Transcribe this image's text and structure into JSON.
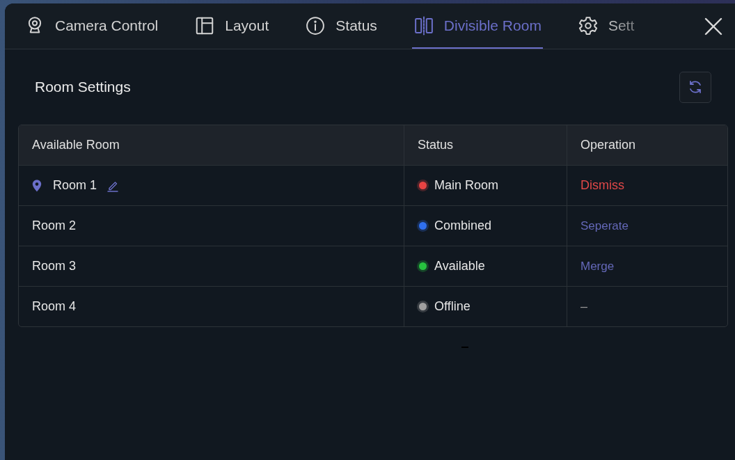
{
  "tabs": [
    {
      "label": "Camera Control",
      "selected": false
    },
    {
      "label": "Layout",
      "selected": false
    },
    {
      "label": "Status",
      "selected": false
    },
    {
      "label": "Divisible Room",
      "selected": true
    },
    {
      "label": "Sett",
      "selected": false
    }
  ],
  "panel": {
    "title": "Room Settings"
  },
  "table": {
    "columns": [
      "Available Room",
      "Status",
      "Operation"
    ],
    "rows": [
      {
        "room": "Room 1",
        "current": true,
        "status": "Main Room",
        "color": "#e84343",
        "operation": "Dismiss",
        "kind": "danger"
      },
      {
        "room": "Room 2",
        "current": false,
        "status": "Combined",
        "color": "#2f6ff0",
        "operation": "Seperate",
        "kind": "action"
      },
      {
        "room": "Room 3",
        "current": false,
        "status": "Available",
        "color": "#27c23f",
        "operation": "Merge",
        "kind": "action"
      },
      {
        "room": "Room 4",
        "current": false,
        "status": "Offline",
        "color": "#a0a0a0",
        "operation": "–",
        "kind": "empty"
      }
    ]
  }
}
